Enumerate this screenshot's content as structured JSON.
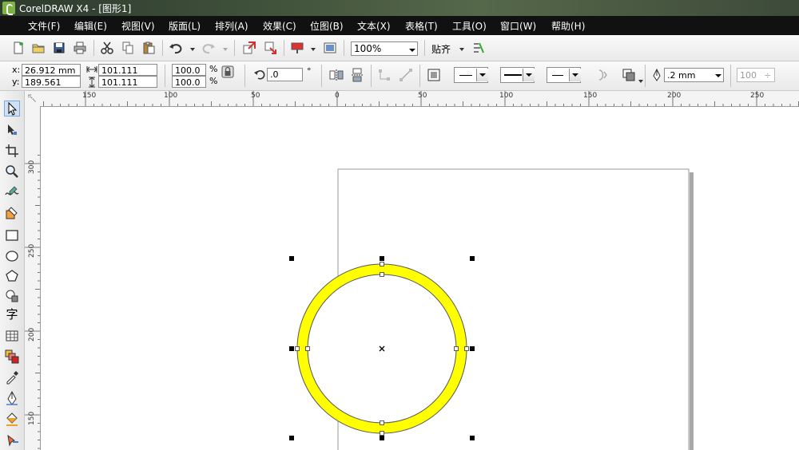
{
  "window": {
    "title": "CorelDRAW X4 - [图形1]"
  },
  "menu": [
    "文件(F)",
    "编辑(E)",
    "视图(V)",
    "版面(L)",
    "排列(A)",
    "效果(C)",
    "位图(B)",
    "文本(X)",
    "表格(T)",
    "工具(O)",
    "窗口(W)",
    "帮助(H)"
  ],
  "standard_toolbar": {
    "zoom_value": "100%",
    "snap_label": "贴齐"
  },
  "property_bar": {
    "x_label": "x:",
    "x_value": "26.912 mm",
    "y_label": "y:",
    "y_value": "189.561 mm",
    "width_value": "101.111 mm",
    "height_value": "101.111 mm",
    "scale_x": "100.0",
    "scale_y": "100.0",
    "percent": "%",
    "rotation_value": ".0",
    "degree": "°",
    "outline_width": ".2 mm",
    "text_value": "100"
  },
  "toolbox": [
    "pick-tool-icon",
    "shape-tool-icon",
    "crop-tool-icon",
    "zoom-tool-icon",
    "freehand-tool-icon",
    "smart-fill-icon",
    "rectangle-tool-icon",
    "ellipse-tool-icon",
    "polygon-tool-icon",
    "basic-shapes-icon",
    "text-tool-icon",
    "table-tool-icon",
    "interactive-blend-icon",
    "eyedropper-icon",
    "outline-tool-icon",
    "fill-tool-icon",
    "interactive-fill-icon"
  ],
  "text_tool_glyph": "字",
  "ruler": {
    "h_labels": [
      "150",
      "100",
      "50",
      "0",
      "50",
      "100",
      "150",
      "200",
      "250"
    ],
    "v_labels": [
      "300",
      "250",
      "200",
      "150"
    ]
  },
  "colors": {
    "fill": "#ffff00",
    "outline": "#555555",
    "menubar": "#111111"
  }
}
